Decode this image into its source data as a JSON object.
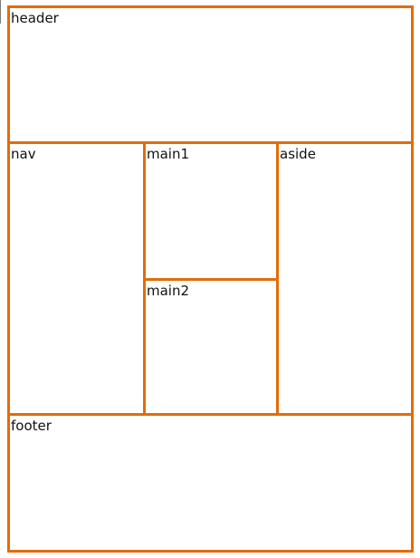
{
  "colors": {
    "border": "#e36c0a",
    "background": "#ffffff",
    "text": "#111111"
  },
  "layout_boxes": {
    "header": "header",
    "nav": "nav",
    "main1": "main1",
    "main2": "main2",
    "aside": "aside",
    "footer": "footer"
  }
}
